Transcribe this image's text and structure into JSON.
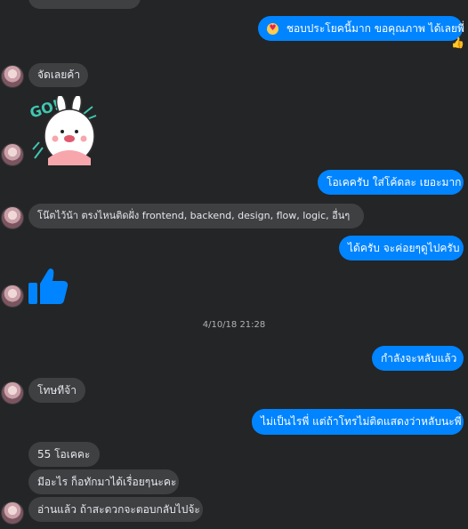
{
  "messages": [
    {
      "id": "m1",
      "text": "ชอบประโยคนี้มาก ขอคุณภาพ ได้เลยพี่",
      "emoji": "😍"
    },
    {
      "id": "m2",
      "text": "จัดเลยค้า"
    },
    {
      "id": "m3",
      "text": "โอเคครับ ใส่โค้ดละ เยอะมาก"
    },
    {
      "id": "m4",
      "text": "โน๊ตไว้น้า ตรงไหนติดฝั่ง frontend, backend, design, flow, logic, อื่นๆ"
    },
    {
      "id": "m5",
      "text": "ได้ครับ จะค่อยๆดูไปครับ"
    },
    {
      "id": "m6",
      "text": "กำลังจะหลับแล้ว"
    },
    {
      "id": "m7",
      "text": "โทษทีจ้า"
    },
    {
      "id": "m8",
      "text": "ไม่เป็นไรพี่ แต่ถ้าโทรไม่ติดแสดงว่าหลับนะพี่"
    },
    {
      "id": "m9",
      "text": "55 โอเคคะ"
    },
    {
      "id": "m10",
      "text": "มีอะไร ก็อทักมาได้เรื่อยๆนะคะ"
    },
    {
      "id": "m11",
      "text": "อ่านแล้ว ถ้าสะดวกจะตอบกลับไปจ้ะ"
    }
  ],
  "timestamp": "4/10/18 21:28",
  "sticker": {
    "text": "GO!",
    "icon": "bunny-sticker"
  },
  "like_icon": "thumbs-up-icon",
  "reaction_icon": "thumbs-up-reaction-icon",
  "colors": {
    "background": "#242526",
    "incoming": "#3e4042",
    "outgoing": "#0084ff",
    "like": "#0084ff"
  }
}
